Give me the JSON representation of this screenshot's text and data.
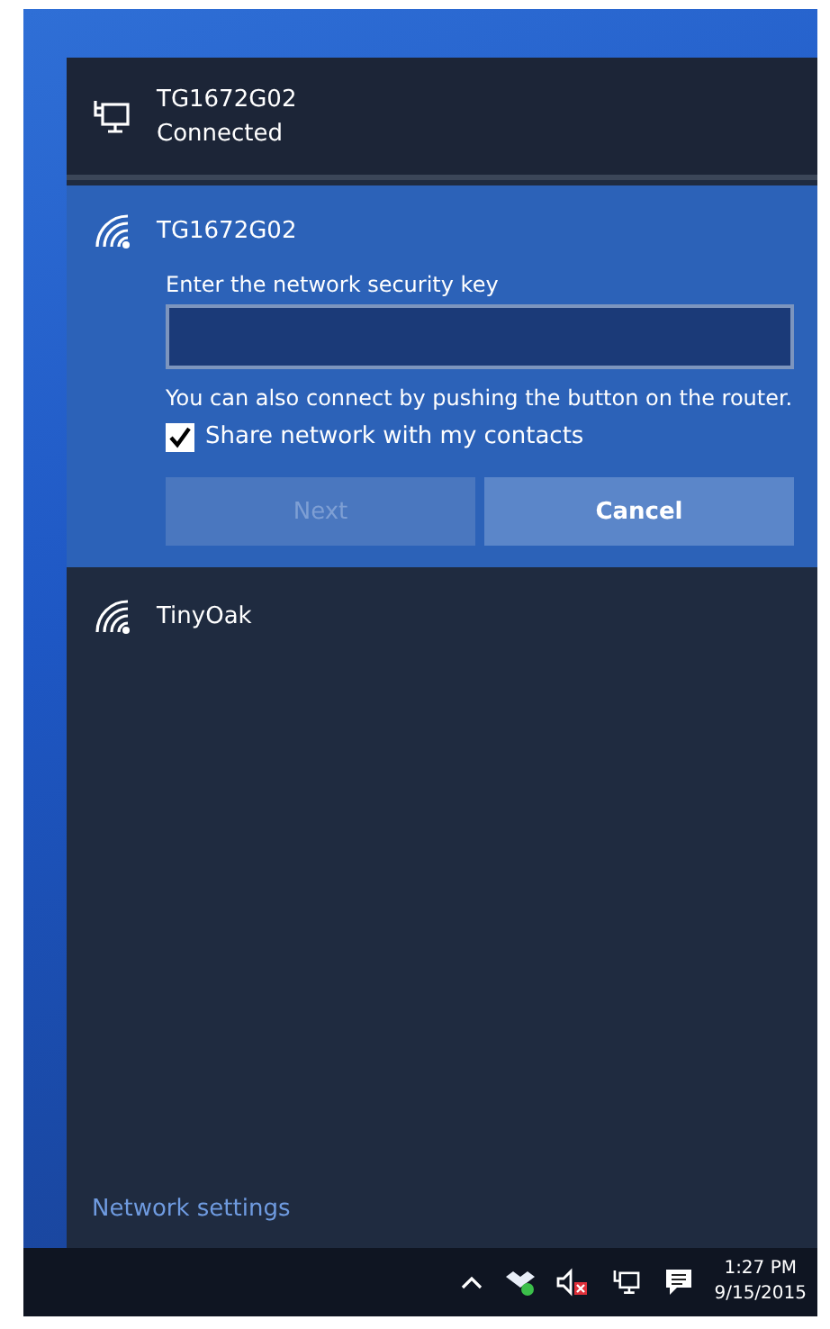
{
  "connected_network": {
    "name": "TG1672G02",
    "status": "Connected"
  },
  "networks": [
    {
      "name": "TG1672G02",
      "expanded": true,
      "key_label": "Enter the network security key",
      "hint": "You can also connect by pushing the button on the router.",
      "share": {
        "label": "Share network with my contacts",
        "checked": true
      },
      "buttons": [
        {
          "label": "Next",
          "disabled": true
        },
        {
          "label": "Cancel",
          "disabled": false
        }
      ]
    },
    {
      "name": "TinyOak",
      "expanded": false
    }
  ],
  "settings_link": "Network settings",
  "taskbar": {
    "time": "1:27 PM",
    "date": "9/15/2015"
  }
}
